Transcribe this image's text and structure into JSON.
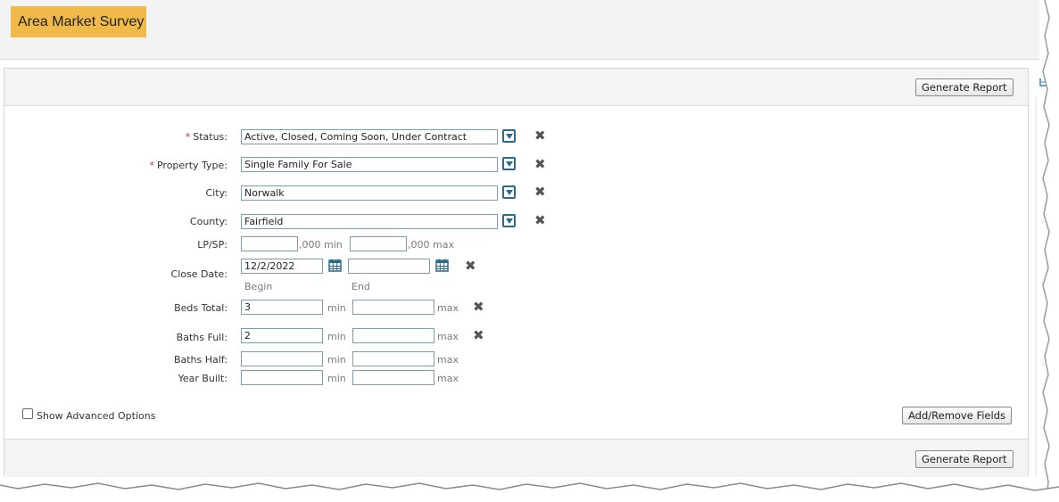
{
  "page": {
    "title": "Area Market Survey"
  },
  "toolbar": {
    "generate_report_label": "Generate Report",
    "add_remove_fields_label": "Add/Remove Fields"
  },
  "form": {
    "status": {
      "label": "Status:",
      "required": "*",
      "value": "Active, Closed, Coming Soon, Under Contract"
    },
    "property_type": {
      "label": "Property Type:",
      "required": "*",
      "value": "Single Family For Sale"
    },
    "city": {
      "label": "City:",
      "value": "Norwalk"
    },
    "county": {
      "label": "County:",
      "value": "Fairfield"
    },
    "lp_sp": {
      "label": "LP/SP:",
      "min_value": "",
      "max_value": "",
      "min_suffix": ",000 min",
      "max_suffix": ",000 max"
    },
    "close_date": {
      "label": "Close Date:",
      "begin_value": "12/2/2022",
      "end_value": "",
      "begin_hint": "Begin",
      "end_hint": "End"
    },
    "beds_total": {
      "label": "Beds Total:",
      "min_value": "3",
      "max_value": "",
      "min_hint": "min",
      "max_hint": "max"
    },
    "baths_full": {
      "label": "Baths Full:",
      "min_value": "2",
      "max_value": "",
      "min_hint": "min",
      "max_hint": "max"
    },
    "baths_half": {
      "label": "Baths Half:",
      "min_value": "",
      "max_value": "",
      "min_hint": "min",
      "max_hint": "max"
    },
    "year_built": {
      "label": "Year Built:",
      "min_value": "",
      "max_value": "",
      "min_hint": "min",
      "max_hint": "max"
    },
    "advanced": {
      "label": "Show Advanced Options",
      "checked": false
    }
  },
  "icons": {
    "dropdown": "chevron-down-icon",
    "clear": "close-icon",
    "calendar": "calendar-icon"
  },
  "colors": {
    "title_badge": "#f0b94a",
    "icon_blue": "#2a6a8a",
    "required": "#c0392b"
  }
}
